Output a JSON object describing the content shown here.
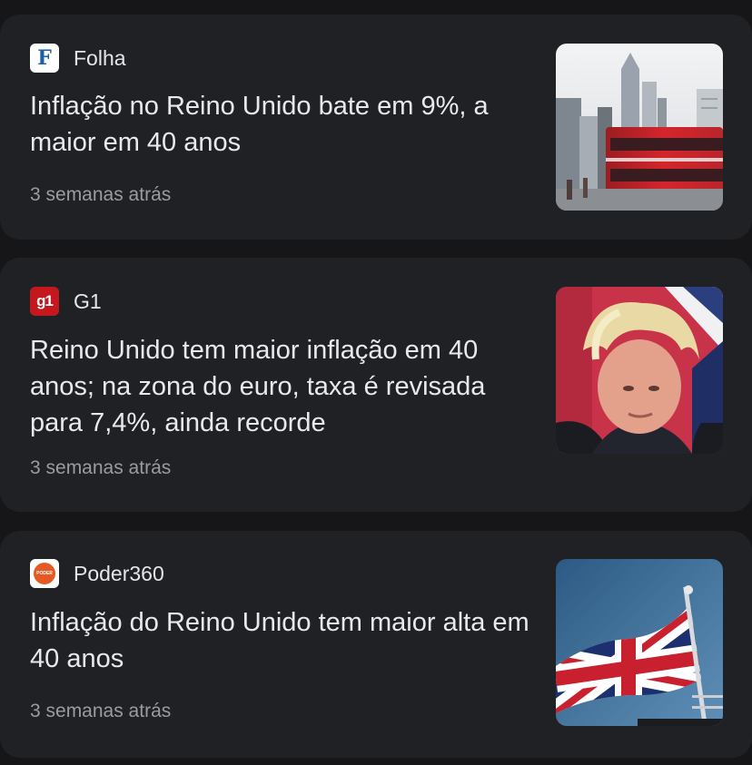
{
  "articles": [
    {
      "source": "Folha",
      "logo_icon": "folha-logo-icon",
      "logo_text": "F",
      "headline": "Inflação no Reino Unido bate em 9%, a maior em 40 anos",
      "time": "3 semanas atrás",
      "thumbnail": "london-bus-skyline-photo"
    },
    {
      "source": "G1",
      "logo_icon": "g1-logo-icon",
      "logo_text": "g1",
      "headline": "Reino Unido tem maior inflação em 40 anos; na zona do euro, taxa é revisada para 7,4%, ainda recorde",
      "time": "3 semanas atrás",
      "thumbnail": "politician-portrait-photo"
    },
    {
      "source": "Poder360",
      "logo_icon": "poder360-logo-icon",
      "logo_text": "PODER",
      "headline": "Inflação do Reino Unido tem maior alta em 40 anos",
      "time": "3 semanas atrás",
      "thumbnail": "union-jack-flag-photo"
    }
  ],
  "colors": {
    "background": "#161619",
    "card": "#202125",
    "headline": "#e9e9ec",
    "meta": "#9b9ba0",
    "g1_red": "#c5181e",
    "folha_blue": "#1b5fa8",
    "poder_orange": "#e55a24"
  }
}
